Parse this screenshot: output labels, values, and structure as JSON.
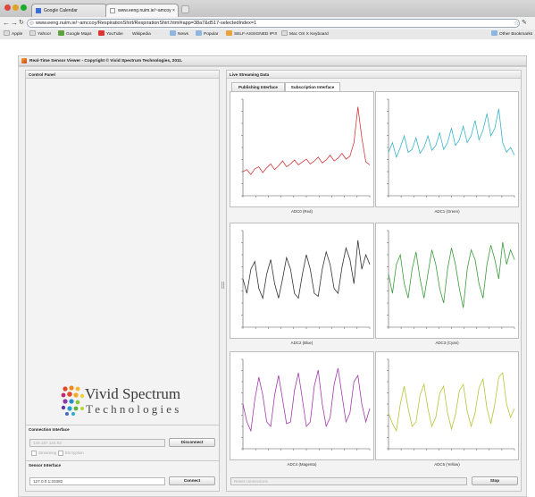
{
  "browser": {
    "tabs": [
      {
        "title": "Google Calendar",
        "active": false
      },
      {
        "title": "www.eeng.nuim.ie/~amcoy ×",
        "active": true
      }
    ],
    "url": "www.eeng.nuim.ie/~amccoy/RespirationShirt/RespirationShirt.html#app=38a7&d517-selectedIndex=1",
    "bookmarks": [
      "Apple",
      "Yahoo!",
      "Google Maps",
      "YouTube",
      "Wikipedia",
      "News",
      "Popular",
      "SELF-ASSIGNED IP!!!",
      "Mac OS X Keyboard"
    ],
    "other_bookmarks": "Other Bookmarks"
  },
  "app": {
    "title": "Real-Time Sensor Viewer - Copyright © Vivid Spectrum Technologies, 2011."
  },
  "control_panel": {
    "title": "Control Panel",
    "logo": {
      "line1": "Vivid Spectrum",
      "line2": "Technologies"
    },
    "connection": {
      "title": "Connection Interface",
      "host_value": "149.157.144.82",
      "connect_button": "Disconnect",
      "checkboxes": [
        "Streaming",
        "Encryption"
      ]
    },
    "sensor": {
      "title": "Sensor Interface",
      "address_value": "127.0.0.1:20382",
      "connect_button": "Connect"
    }
  },
  "streaming": {
    "title": "Live Streaming Data",
    "tabs": [
      "Publishing Interface",
      "Subscription Interface"
    ],
    "active_tab": 1,
    "status_placeholder": "Reset connections",
    "stop_button": "Stop"
  },
  "chart_data": [
    {
      "type": "line",
      "title": "ADC0 (Red)",
      "color": "#d23a3a",
      "values": [
        0.25,
        0.27,
        0.22,
        0.28,
        0.3,
        0.24,
        0.29,
        0.33,
        0.27,
        0.31,
        0.36,
        0.3,
        0.33,
        0.37,
        0.32,
        0.35,
        0.38,
        0.33,
        0.36,
        0.4,
        0.34,
        0.37,
        0.42,
        0.36,
        0.39,
        0.44,
        0.38,
        0.41,
        0.55,
        0.92,
        0.6,
        0.35,
        0.32
      ]
    },
    {
      "type": "line",
      "title": "ADC1 (Green)",
      "color": "#3bb3c8",
      "values": [
        0.45,
        0.55,
        0.4,
        0.5,
        0.62,
        0.45,
        0.48,
        0.6,
        0.44,
        0.5,
        0.62,
        0.47,
        0.52,
        0.65,
        0.48,
        0.55,
        0.7,
        0.52,
        0.58,
        0.72,
        0.55,
        0.62,
        0.78,
        0.58,
        0.68,
        0.85,
        0.62,
        0.7,
        0.9,
        0.55,
        0.45,
        0.5,
        0.42
      ]
    },
    {
      "type": "line",
      "title": "ADC2 (Blue)",
      "color": "#333333",
      "values": [
        0.5,
        0.35,
        0.6,
        0.68,
        0.4,
        0.3,
        0.55,
        0.7,
        0.45,
        0.3,
        0.5,
        0.72,
        0.6,
        0.35,
        0.3,
        0.55,
        0.75,
        0.6,
        0.35,
        0.32,
        0.6,
        0.78,
        0.65,
        0.4,
        0.35,
        0.62,
        0.82,
        0.7,
        0.45,
        0.9,
        0.6,
        0.75,
        0.65
      ]
    },
    {
      "type": "line",
      "title": "ADC3 (Cyan)",
      "color": "#3a9a3a",
      "values": [
        0.55,
        0.35,
        0.65,
        0.75,
        0.45,
        0.3,
        0.6,
        0.78,
        0.5,
        0.3,
        0.55,
        0.8,
        0.65,
        0.4,
        0.25,
        0.6,
        0.82,
        0.65,
        0.4,
        0.2,
        0.6,
        0.8,
        0.7,
        0.45,
        0.3,
        0.65,
        0.85,
        0.7,
        0.5,
        0.88,
        0.65,
        0.8,
        0.7
      ]
    },
    {
      "type": "line",
      "title": "ADC4 (Magenta)",
      "color": "#a03aa8",
      "values": [
        0.5,
        0.3,
        0.2,
        0.55,
        0.8,
        0.6,
        0.3,
        0.25,
        0.6,
        0.82,
        0.55,
        0.28,
        0.3,
        0.65,
        0.85,
        0.55,
        0.25,
        0.3,
        0.7,
        0.88,
        0.5,
        0.25,
        0.35,
        0.72,
        0.9,
        0.6,
        0.3,
        0.4,
        0.75,
        0.82,
        0.5,
        0.3,
        0.45
      ]
    },
    {
      "type": "line",
      "title": "ADC5 (Yellow)",
      "color": "#b8c43a",
      "values": [
        0.4,
        0.28,
        0.2,
        0.5,
        0.7,
        0.45,
        0.25,
        0.3,
        0.6,
        0.72,
        0.45,
        0.25,
        0.35,
        0.62,
        0.7,
        0.4,
        0.22,
        0.38,
        0.65,
        0.72,
        0.42,
        0.25,
        0.4,
        0.68,
        0.78,
        0.45,
        0.28,
        0.5,
        0.8,
        0.85,
        0.5,
        0.35,
        0.45
      ]
    }
  ]
}
